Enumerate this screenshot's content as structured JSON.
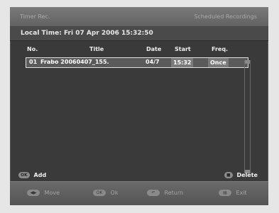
{
  "header": {
    "title": "Timer Rec.",
    "subtitle": "Scheduled Recordings",
    "local_time": "Local Time: Fri 07 Apr 2006 15:32:50"
  },
  "table": {
    "columns": [
      "No.",
      "Title",
      "Date",
      "Start",
      "Freq."
    ],
    "rows": [
      {
        "no": "01",
        "title": "Frabo 20060407_155.",
        "date": "04/7",
        "start": "15:32",
        "freq": "Once"
      }
    ]
  },
  "actions": {
    "add": "Add",
    "delete": "Delete",
    "add_key": "OK",
    "delete_key": "■"
  },
  "footer": {
    "move": "Move",
    "ok": "Ok",
    "return": "Return",
    "exit": "Exit",
    "move_icon": "◀▶",
    "ok_icon": "OK",
    "return_icon": "↶",
    "exit_icon": "▤"
  }
}
